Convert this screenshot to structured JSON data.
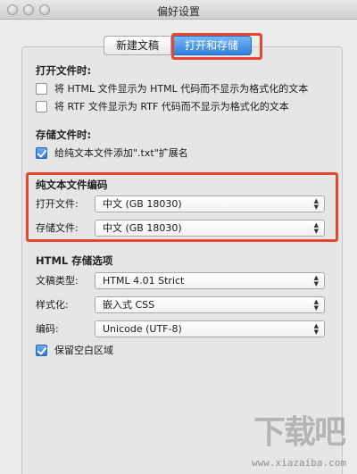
{
  "window": {
    "title": "偏好设置"
  },
  "tabs": [
    {
      "label": "新建文稿",
      "active": false
    },
    {
      "label": "打开和存储",
      "active": true
    }
  ],
  "open_section": {
    "title": "打开文件时:",
    "options": [
      {
        "label": "将 HTML 文件显示为 HTML 代码而不显示为格式化的文本",
        "checked": false
      },
      {
        "label": "将 RTF 文件显示为 RTF 代码而不显示为格式化的文本",
        "checked": false
      }
    ]
  },
  "save_section": {
    "title": "存储文件时:",
    "options": [
      {
        "label": "给纯文本文件添加\".txt\"扩展名",
        "checked": true
      }
    ]
  },
  "encoding_section": {
    "title": "纯文本文件编码",
    "open_label": "打开文件:",
    "open_value": "中文 (GB 18030)",
    "save_label": "存储文件:",
    "save_value": "中文 (GB 18030)"
  },
  "html_section": {
    "title": "HTML 存储选项",
    "doctype_label": "文稿类型:",
    "doctype_value": "HTML 4.01 Strict",
    "style_label": "样式化:",
    "style_value": "嵌入式 CSS",
    "encoding_label": "编码:",
    "encoding_value": "Unicode (UTF-8)",
    "preserve_label": "保留空白区域",
    "preserve_checked": true
  },
  "watermark": {
    "text": "下载吧",
    "url": "www.xiazaiba.com"
  },
  "colors": {
    "highlight": "#e5472e",
    "accent": "#2f7fdc"
  }
}
